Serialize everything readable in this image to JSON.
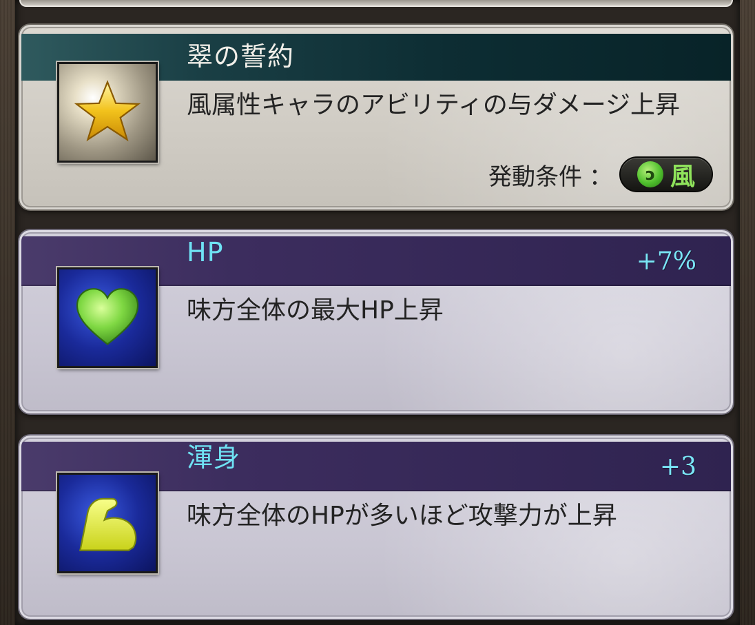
{
  "skills": [
    {
      "title": "翠の誓約",
      "description": "風属性キャラのアビリティの与ダメージ上昇",
      "icon": "star-icon",
      "condition_label": "発動条件",
      "condition_colon": "：",
      "element": "風",
      "element_icon": "wind-icon"
    },
    {
      "title": "HP",
      "value": "+7%",
      "description": "味方全体の最大HP上昇",
      "icon": "heart-icon"
    },
    {
      "title": "渾身",
      "value": "+3",
      "description": "味方全体のHPが多いほど攻撃力が上昇",
      "icon": "flexed-arm-icon"
    }
  ],
  "colors": {
    "accent_title": "#6fe2f4",
    "wind": "#8fe35b",
    "gray_band": "#0d2d33",
    "purple_band": "#3c2d5e"
  }
}
